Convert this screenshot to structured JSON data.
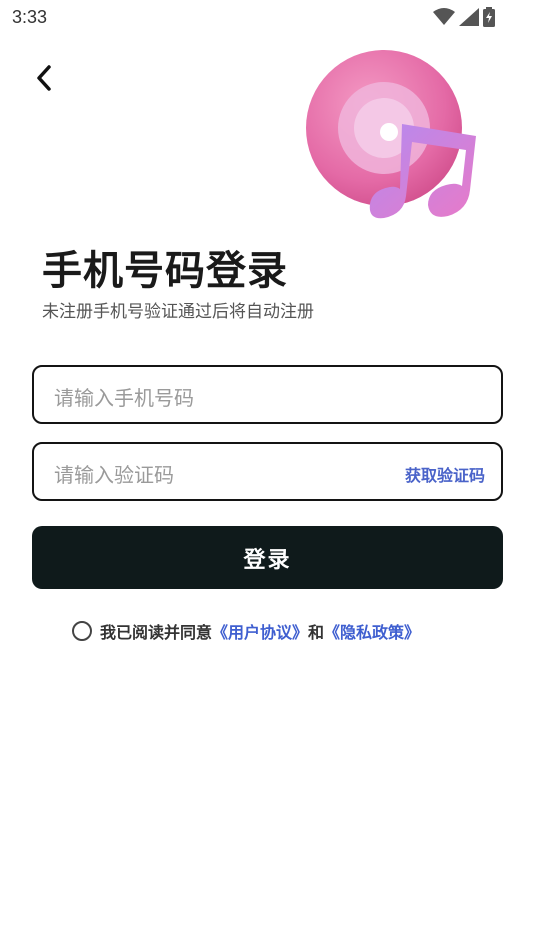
{
  "status_bar": {
    "time": "3:33"
  },
  "header": {
    "title": "手机号码登录",
    "subtitle": "未注册手机号验证通过后将自动注册"
  },
  "form": {
    "phone_placeholder": "请输入手机号码",
    "code_placeholder": "请输入验证码",
    "get_code_label": "获取验证码",
    "login_label": "登录"
  },
  "agreement": {
    "prefix": "我已阅读并同意",
    "user_agreement": "《用户协议》",
    "conjunction": "和",
    "privacy_policy": "《隐私政策》"
  },
  "colors": {
    "link": "#3f5fd0",
    "button_bg": "#0f1a1b",
    "accent_pink": "#e86aa6",
    "accent_purple": "#a070e6"
  }
}
